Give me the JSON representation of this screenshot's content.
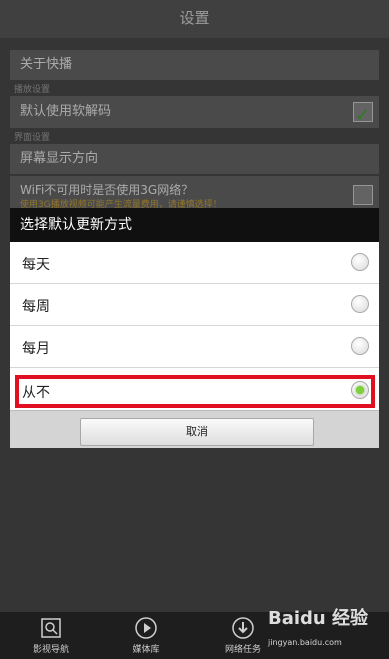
{
  "titlebar": {
    "title": "设置"
  },
  "settings": {
    "about": "关于快播",
    "section_decode": "播放设置",
    "soft_decode": "默认使用软解码",
    "section_display": "界面设置",
    "orientation": "屏幕显示方向",
    "wifi_3g": "WiFi不可用时是否使用3G网络？",
    "wifi_3g_note": "使用3G播放视频可能产生流量费用，请谨慎选择！"
  },
  "dialog": {
    "title": "选择默认更新方式",
    "options": [
      {
        "label": "每天",
        "selected": false
      },
      {
        "label": "每周",
        "selected": false
      },
      {
        "label": "每月",
        "selected": false
      },
      {
        "label": "从不",
        "selected": true
      }
    ],
    "cancel_label": "取消"
  },
  "bottom_nav": {
    "items": [
      {
        "label": "影视导航",
        "icon": "film-icon"
      },
      {
        "label": "媒体库",
        "icon": "play-icon"
      },
      {
        "label": "网络任务",
        "icon": "download-icon"
      }
    ]
  },
  "watermark": {
    "brand": "Baidu 经验",
    "url": "jingyan.baidu.com"
  },
  "colors": {
    "highlight": "#e01020",
    "radio_selected": "#7fcf3a",
    "check": "#45a832"
  }
}
